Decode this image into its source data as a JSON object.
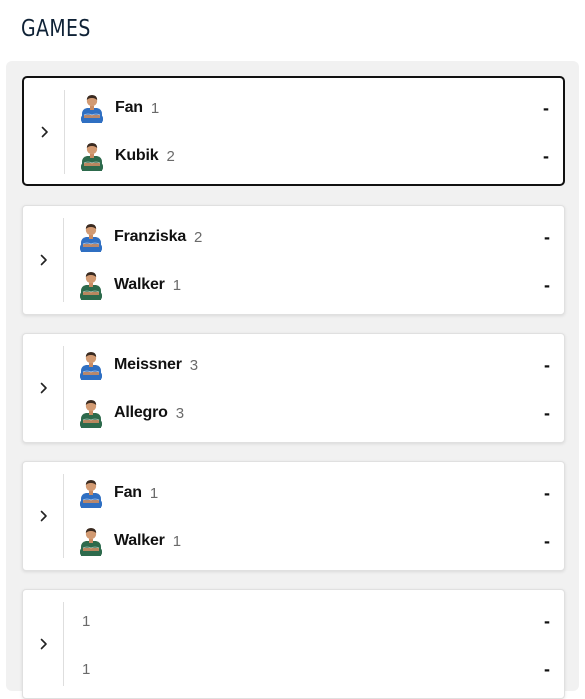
{
  "page": {
    "title": "GAMES"
  },
  "colors": {
    "home_jersey": "#2f6fc2",
    "away_jersey": "#2d6a4c",
    "selected_border": "#111111",
    "panel_background": "#f1f1f1"
  },
  "icons": {
    "expand": "chevron-right-icon",
    "home_player": "player-blue-jersey-icon",
    "away_player": "player-green-jersey-icon"
  },
  "games": [
    {
      "selected": true,
      "players": [
        {
          "name": "Fan",
          "seed": "1",
          "score": "-",
          "jersey": "blue"
        },
        {
          "name": "Kubik",
          "seed": "2",
          "score": "-",
          "jersey": "green"
        }
      ]
    },
    {
      "selected": false,
      "players": [
        {
          "name": "Franziska",
          "seed": "2",
          "score": "-",
          "jersey": "blue"
        },
        {
          "name": "Walker",
          "seed": "1",
          "score": "-",
          "jersey": "green"
        }
      ]
    },
    {
      "selected": false,
      "players": [
        {
          "name": "Meissner",
          "seed": "3",
          "score": "-",
          "jersey": "blue"
        },
        {
          "name": "Allegro",
          "seed": "3",
          "score": "-",
          "jersey": "green"
        }
      ]
    },
    {
      "selected": false,
      "players": [
        {
          "name": "Fan",
          "seed": "1",
          "score": "-",
          "jersey": "blue"
        },
        {
          "name": "Walker",
          "seed": "1",
          "score": "-",
          "jersey": "green"
        }
      ]
    },
    {
      "selected": false,
      "players": [
        {
          "name": "",
          "seed": "1",
          "score": "-",
          "jersey": "none"
        },
        {
          "name": "",
          "seed": "1",
          "score": "-",
          "jersey": "none"
        }
      ]
    }
  ]
}
